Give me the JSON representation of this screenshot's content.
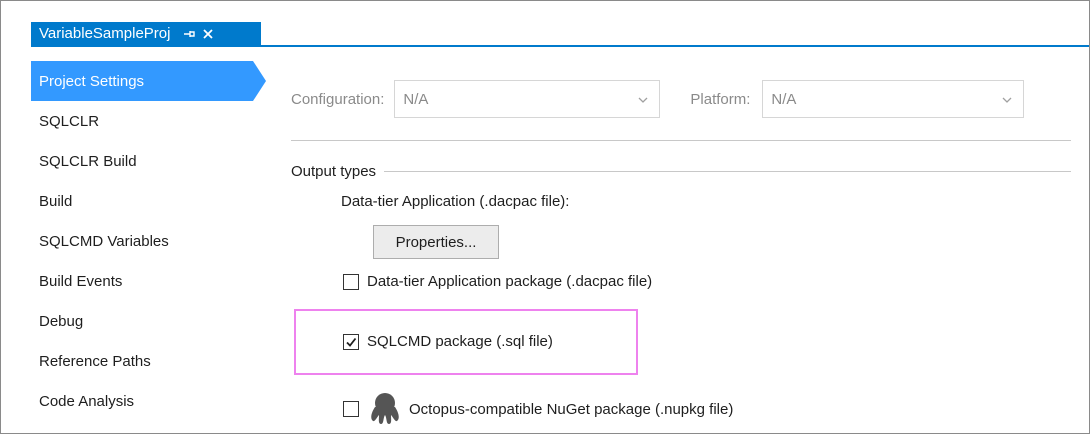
{
  "tab": {
    "title": "VariableSampleProj",
    "pin_icon": "pin-icon",
    "close_icon": "close-icon",
    "accent": "#007acc"
  },
  "sidebar": {
    "items": [
      {
        "label": "Project Settings",
        "active": true
      },
      {
        "label": "SQLCLR"
      },
      {
        "label": "SQLCLR Build"
      },
      {
        "label": "Build"
      },
      {
        "label": "SQLCMD Variables"
      },
      {
        "label": "Build Events"
      },
      {
        "label": "Debug"
      },
      {
        "label": "Reference Paths"
      },
      {
        "label": "Code Analysis"
      }
    ],
    "active_color": "#3399ff"
  },
  "config": {
    "configuration_label": "Configuration:",
    "configuration_value": "N/A",
    "platform_label": "Platform:",
    "platform_value": "N/A"
  },
  "output": {
    "header": "Output types",
    "dacpac_label": "Data-tier Application (.dacpac file):",
    "properties_button": "Properties...",
    "options": [
      {
        "label": "Data-tier Application package (.dacpac file)",
        "checked": false
      },
      {
        "label": "SQLCMD package (.sql file)",
        "checked": true
      },
      {
        "label": "Octopus-compatible NuGet package (.nupkg file)",
        "checked": false,
        "icon": "octopus-icon"
      }
    ],
    "highlight_color": "#ee82ee"
  }
}
